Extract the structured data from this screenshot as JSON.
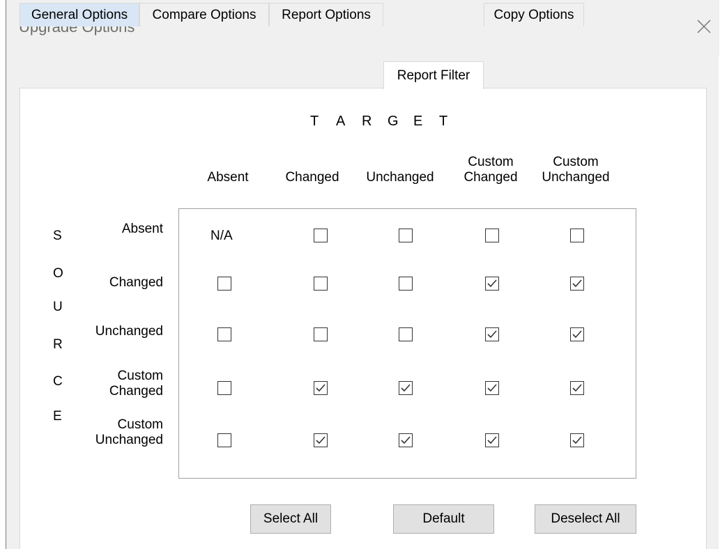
{
  "window": {
    "title": "Upgrade Options"
  },
  "tabs": [
    {
      "label": "General Options"
    },
    {
      "label": "Compare Options"
    },
    {
      "label": "Report Options"
    },
    {
      "label": "Report Filter"
    },
    {
      "label": "Copy Options"
    }
  ],
  "active_tab": "Report Filter",
  "target_heading": [
    "T",
    "A",
    "R",
    "G",
    "E",
    "T"
  ],
  "source_heading": [
    "S",
    "O",
    "U",
    "R",
    "C",
    "E"
  ],
  "columns": [
    {
      "line1": "",
      "line2": "Absent"
    },
    {
      "line1": "",
      "line2": "Changed"
    },
    {
      "line1": "",
      "line2": "Unchanged"
    },
    {
      "line1": "Custom",
      "line2": "Changed"
    },
    {
      "line1": "Custom",
      "line2": "Unchanged"
    }
  ],
  "rows": [
    {
      "line1": "",
      "line2": "Absent",
      "cells": [
        "N/A",
        false,
        false,
        false,
        false
      ]
    },
    {
      "line1": "",
      "line2": "Changed",
      "cells": [
        false,
        false,
        false,
        true,
        true
      ]
    },
    {
      "line1": "",
      "line2": "Unchanged",
      "cells": [
        false,
        false,
        false,
        true,
        true
      ]
    },
    {
      "line1": "Custom",
      "line2": "Changed",
      "cells": [
        false,
        true,
        true,
        true,
        true
      ]
    },
    {
      "line1": "Custom",
      "line2": "Unchanged",
      "cells": [
        false,
        true,
        true,
        true,
        true
      ]
    }
  ],
  "buttons": {
    "select_all": "Select All",
    "default": "Default",
    "deselect_all": "Deselect All"
  },
  "icons": {
    "close": "close-icon",
    "check": "check-icon"
  },
  "colors": {
    "first_tab_bg": "#d9e6f5",
    "checkbox_border": "#333333",
    "check_mark": "#333333"
  }
}
